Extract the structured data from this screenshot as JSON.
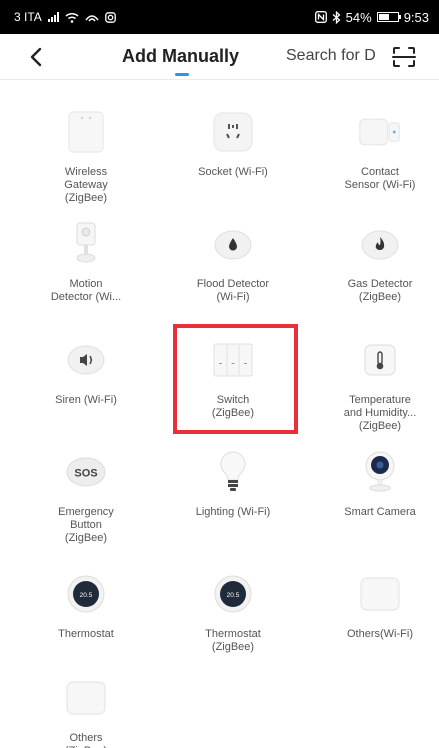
{
  "status_bar": {
    "carrier": "3 ITA",
    "battery": "54%",
    "time": "9:53"
  },
  "header": {
    "title": "Add Manually",
    "search_label": "Search for D"
  },
  "devices": [
    {
      "label": "Wireless\nGateway\n(ZigBee)",
      "icon": "gateway-icon"
    },
    {
      "label": "Socket (Wi-Fi)",
      "icon": "socket-icon"
    },
    {
      "label": "Contact\nSensor (Wi-Fi)",
      "icon": "contact-sensor-icon"
    },
    {
      "label": "Motion\nDetector (Wi...",
      "icon": "motion-detector-icon"
    },
    {
      "label": "Flood Detector\n(Wi-Fi)",
      "icon": "water-drop-icon"
    },
    {
      "label": "Gas Detector\n(ZigBee)",
      "icon": "flame-icon"
    },
    {
      "label": "Siren (Wi-Fi)",
      "icon": "speaker-icon"
    },
    {
      "label": "Switch\n(ZigBee)",
      "icon": "wall-switch-icon"
    },
    {
      "label": "Temperature\nand Humidity...\n(ZigBee)",
      "icon": "thermometer-icon"
    },
    {
      "label": "Emergency\nButton\n(ZigBee)",
      "icon": "sos-icon"
    },
    {
      "label": "Lighting (Wi-Fi)",
      "icon": "light-bulb-icon"
    },
    {
      "label": "Smart Camera",
      "icon": "camera-icon"
    },
    {
      "label": "Thermostat",
      "icon": "thermostat-icon",
      "reading": "20.5"
    },
    {
      "label": "Thermostat\n(ZigBee)",
      "icon": "thermostat-icon",
      "reading": "20.5"
    },
    {
      "label": "Others(Wi-Fi)",
      "icon": "generic-device-icon"
    },
    {
      "label": "Others\n(ZigBee)",
      "icon": "generic-device-icon"
    }
  ],
  "highlight_color": "#e8303b",
  "accent_color": "#1e9bf0"
}
